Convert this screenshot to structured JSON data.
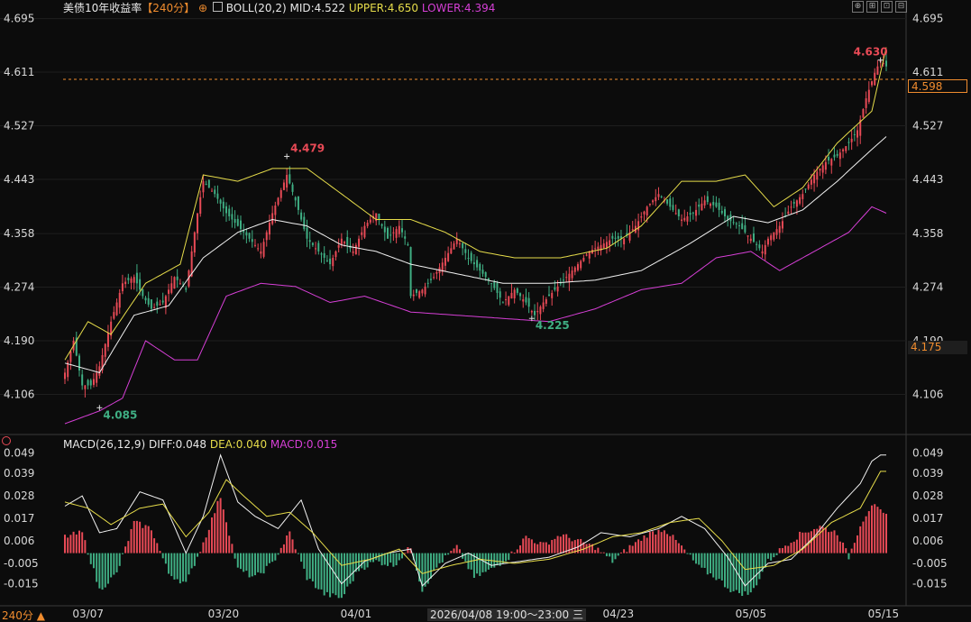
{
  "main_header": {
    "title": "美债10年收益率",
    "period_tag": "【240分】",
    "boll_label": "BOLL(20,2)",
    "mid": "MID:4.522",
    "upper": "UPPER:4.650",
    "lower": "LOWER:4.394"
  },
  "macd_header": {
    "label": "MACD(26,12,9)",
    "diff": "DIFF:0.048",
    "dea": "DEA:0.040",
    "macd": "MACD:0.015"
  },
  "toolbar": {
    "btn1": "⊕",
    "btn2": "⊞",
    "btn3": "⊡",
    "btn4": "⊟"
  },
  "price_marker": {
    "last": "4.598",
    "crosshair": "4.175"
  },
  "footer": {
    "period": "240分 ▲",
    "crosshair_time": "2026/04/08 19:00～23:00 三"
  },
  "colors": {
    "up": "#e84a56",
    "down": "#3fae83",
    "upper": "#e6dc4a",
    "mid": "#f0f0f0",
    "lower": "#d63fd6",
    "dea": "#e6dc4a",
    "diff": "#f0f0f0",
    "marker": "#f08c2e"
  },
  "chart_data": [
    {
      "type": "candlestick",
      "title": "美债10年收益率",
      "y_ticks": [
        "4.695",
        "4.611",
        "4.527",
        "4.443",
        "4.358",
        "4.274",
        "4.190",
        "4.106"
      ],
      "ylim": [
        4.06,
        4.71
      ],
      "x_ticks": [
        "03/07",
        "03/20",
        "04/01",
        "04/23",
        "05/05",
        "05/15"
      ],
      "annotations": [
        {
          "label": "4.479",
          "x": 77,
          "value": 4.479,
          "kind": "high"
        },
        {
          "label": "4.085",
          "x": 12,
          "value": 4.085,
          "kind": "low"
        },
        {
          "label": "4.225",
          "x": 162,
          "value": 4.225,
          "kind": "low"
        },
        {
          "label": "4.630",
          "x": 283,
          "value": 4.63,
          "kind": "high"
        }
      ],
      "anchors": [
        [
          0,
          4.14
        ],
        [
          3,
          4.19
        ],
        [
          6,
          4.12
        ],
        [
          9,
          4.12
        ],
        [
          12,
          4.15
        ],
        [
          16,
          4.22
        ],
        [
          20,
          4.28
        ],
        [
          24,
          4.29
        ],
        [
          27,
          4.26
        ],
        [
          30,
          4.24
        ],
        [
          34,
          4.25
        ],
        [
          38,
          4.29
        ],
        [
          42,
          4.27
        ],
        [
          46,
          4.39
        ],
        [
          48,
          4.44
        ],
        [
          52,
          4.42
        ],
        [
          56,
          4.39
        ],
        [
          60,
          4.37
        ],
        [
          64,
          4.35
        ],
        [
          68,
          4.33
        ],
        [
          72,
          4.39
        ],
        [
          77,
          4.45
        ],
        [
          80,
          4.41
        ],
        [
          84,
          4.35
        ],
        [
          88,
          4.33
        ],
        [
          92,
          4.31
        ],
        [
          96,
          4.35
        ],
        [
          100,
          4.33
        ],
        [
          104,
          4.37
        ],
        [
          108,
          4.39
        ],
        [
          112,
          4.35
        ],
        [
          116,
          4.37
        ],
        [
          119,
          4.34
        ],
        [
          120,
          4.26
        ],
        [
          124,
          4.27
        ],
        [
          128,
          4.29
        ],
        [
          132,
          4.32
        ],
        [
          136,
          4.35
        ],
        [
          140,
          4.32
        ],
        [
          144,
          4.3
        ],
        [
          148,
          4.28
        ],
        [
          152,
          4.25
        ],
        [
          156,
          4.27
        ],
        [
          160,
          4.25
        ],
        [
          163,
          4.23
        ],
        [
          166,
          4.25
        ],
        [
          170,
          4.27
        ],
        [
          174,
          4.29
        ],
        [
          178,
          4.31
        ],
        [
          182,
          4.33
        ],
        [
          186,
          4.34
        ],
        [
          190,
          4.35
        ],
        [
          194,
          4.35
        ],
        [
          198,
          4.37
        ],
        [
          202,
          4.4
        ],
        [
          206,
          4.42
        ],
        [
          210,
          4.4
        ],
        [
          214,
          4.38
        ],
        [
          218,
          4.39
        ],
        [
          222,
          4.41
        ],
        [
          226,
          4.4
        ],
        [
          230,
          4.38
        ],
        [
          234,
          4.37
        ],
        [
          238,
          4.35
        ],
        [
          242,
          4.33
        ],
        [
          244,
          4.35
        ],
        [
          248,
          4.37
        ],
        [
          252,
          4.4
        ],
        [
          256,
          4.42
        ],
        [
          260,
          4.45
        ],
        [
          264,
          4.47
        ],
        [
          268,
          4.48
        ],
        [
          272,
          4.5
        ],
        [
          275,
          4.52
        ],
        [
          278,
          4.57
        ],
        [
          281,
          4.61
        ],
        [
          283,
          4.63
        ],
        [
          285,
          4.62
        ]
      ],
      "series": [
        {
          "name": "MID",
          "anchors": [
            [
              0,
              4.155
            ],
            [
              12,
              4.14
            ],
            [
              24,
              4.23
            ],
            [
              36,
              4.245
            ],
            [
              48,
              4.32
            ],
            [
              60,
              4.36
            ],
            [
              72,
              4.38
            ],
            [
              84,
              4.37
            ],
            [
              96,
              4.34
            ],
            [
              108,
              4.33
            ],
            [
              120,
              4.31
            ],
            [
              136,
              4.295
            ],
            [
              152,
              4.28
            ],
            [
              168,
              4.28
            ],
            [
              184,
              4.285
            ],
            [
              200,
              4.3
            ],
            [
              216,
              4.34
            ],
            [
              232,
              4.385
            ],
            [
              244,
              4.375
            ],
            [
              256,
              4.395
            ],
            [
              268,
              4.44
            ],
            [
              280,
              4.49
            ],
            [
              285,
              4.51
            ]
          ]
        },
        {
          "name": "UPPER",
          "anchors": [
            [
              0,
              4.16
            ],
            [
              8,
              4.22
            ],
            [
              16,
              4.2
            ],
            [
              28,
              4.28
            ],
            [
              40,
              4.31
            ],
            [
              48,
              4.45
            ],
            [
              60,
              4.44
            ],
            [
              72,
              4.46
            ],
            [
              84,
              4.46
            ],
            [
              96,
              4.42
            ],
            [
              108,
              4.38
            ],
            [
              120,
              4.38
            ],
            [
              132,
              4.36
            ],
            [
              144,
              4.33
            ],
            [
              156,
              4.32
            ],
            [
              172,
              4.32
            ],
            [
              188,
              4.335
            ],
            [
              200,
              4.37
            ],
            [
              214,
              4.44
            ],
            [
              226,
              4.44
            ],
            [
              236,
              4.45
            ],
            [
              246,
              4.4
            ],
            [
              256,
              4.43
            ],
            [
              268,
              4.5
            ],
            [
              280,
              4.55
            ],
            [
              285,
              4.65
            ]
          ]
        },
        {
          "name": "LOWER",
          "anchors": [
            [
              0,
              4.06
            ],
            [
              12,
              4.08
            ],
            [
              20,
              4.1
            ],
            [
              28,
              4.19
            ],
            [
              38,
              4.16
            ],
            [
              46,
              4.16
            ],
            [
              56,
              4.26
            ],
            [
              68,
              4.28
            ],
            [
              80,
              4.275
            ],
            [
              92,
              4.25
            ],
            [
              104,
              4.26
            ],
            [
              120,
              4.235
            ],
            [
              136,
              4.23
            ],
            [
              152,
              4.225
            ],
            [
              168,
              4.22
            ],
            [
              184,
              4.24
            ],
            [
              200,
              4.27
            ],
            [
              214,
              4.28
            ],
            [
              226,
              4.32
            ],
            [
              238,
              4.33
            ],
            [
              248,
              4.3
            ],
            [
              260,
              4.33
            ],
            [
              272,
              4.36
            ],
            [
              280,
              4.4
            ],
            [
              285,
              4.39
            ]
          ]
        }
      ]
    },
    {
      "type": "bar",
      "title": "MACD(26,12,9)",
      "y_ticks": [
        "0.049",
        "0.039",
        "0.028",
        "0.017",
        "0.006",
        "-0.005",
        "-0.015"
      ],
      "ylim": [
        -0.024,
        0.051
      ],
      "series": [
        {
          "name": "DIFF",
          "anchors": [
            [
              0,
              0.023
            ],
            [
              6,
              0.028
            ],
            [
              12,
              0.01
            ],
            [
              18,
              0.012
            ],
            [
              26,
              0.03
            ],
            [
              34,
              0.026
            ],
            [
              42,
              0.0
            ],
            [
              48,
              0.018
            ],
            [
              54,
              0.048
            ],
            [
              60,
              0.025
            ],
            [
              66,
              0.018
            ],
            [
              74,
              0.012
            ],
            [
              82,
              0.026
            ],
            [
              88,
              0.002
            ],
            [
              96,
              -0.015
            ],
            [
              104,
              -0.004
            ],
            [
              112,
              0.0
            ],
            [
              120,
              0.002
            ],
            [
              124,
              -0.016
            ],
            [
              132,
              -0.005
            ],
            [
              140,
              0.0
            ],
            [
              148,
              -0.006
            ],
            [
              158,
              -0.004
            ],
            [
              168,
              -0.002
            ],
            [
              178,
              0.003
            ],
            [
              186,
              0.01
            ],
            [
              196,
              0.008
            ],
            [
              206,
              0.012
            ],
            [
              214,
              0.018
            ],
            [
              222,
              0.012
            ],
            [
              230,
              -0.002
            ],
            [
              236,
              -0.016
            ],
            [
              244,
              -0.005
            ],
            [
              252,
              -0.003
            ],
            [
              260,
              0.008
            ],
            [
              268,
              0.022
            ],
            [
              276,
              0.034
            ],
            [
              280,
              0.045
            ],
            [
              283,
              0.048
            ]
          ]
        },
        {
          "name": "DEA",
          "anchors": [
            [
              0,
              0.025
            ],
            [
              8,
              0.022
            ],
            [
              16,
              0.014
            ],
            [
              26,
              0.022
            ],
            [
              34,
              0.024
            ],
            [
              42,
              0.008
            ],
            [
              50,
              0.02
            ],
            [
              56,
              0.036
            ],
            [
              62,
              0.028
            ],
            [
              70,
              0.018
            ],
            [
              78,
              0.02
            ],
            [
              86,
              0.01
            ],
            [
              96,
              -0.006
            ],
            [
              106,
              -0.003
            ],
            [
              116,
              0.002
            ],
            [
              124,
              -0.01
            ],
            [
              134,
              -0.006
            ],
            [
              144,
              -0.003
            ],
            [
              156,
              -0.005
            ],
            [
              168,
              -0.003
            ],
            [
              180,
              0.002
            ],
            [
              190,
              0.008
            ],
            [
              200,
              0.01
            ],
            [
              210,
              0.015
            ],
            [
              220,
              0.017
            ],
            [
              228,
              0.006
            ],
            [
              236,
              -0.008
            ],
            [
              246,
              -0.006
            ],
            [
              256,
              0.002
            ],
            [
              266,
              0.015
            ],
            [
              276,
              0.022
            ],
            [
              283,
              0.04
            ]
          ]
        },
        {
          "name": "MACD",
          "anchors": [
            [
              0,
              0.008
            ],
            [
              6,
              0.01
            ],
            [
              12,
              -0.018
            ],
            [
              18,
              -0.01
            ],
            [
              24,
              0.015
            ],
            [
              30,
              0.012
            ],
            [
              36,
              -0.01
            ],
            [
              42,
              -0.015
            ],
            [
              48,
              0.005
            ],
            [
              54,
              0.028
            ],
            [
              60,
              -0.008
            ],
            [
              66,
              -0.012
            ],
            [
              72,
              -0.005
            ],
            [
              78,
              0.01
            ],
            [
              84,
              -0.012
            ],
            [
              90,
              -0.02
            ],
            [
              96,
              -0.022
            ],
            [
              102,
              -0.008
            ],
            [
              108,
              -0.004
            ],
            [
              114,
              -0.006
            ],
            [
              120,
              0.003
            ],
            [
              124,
              -0.018
            ],
            [
              130,
              -0.005
            ],
            [
              136,
              0.003
            ],
            [
              142,
              -0.012
            ],
            [
              148,
              -0.008
            ],
            [
              154,
              -0.002
            ],
            [
              160,
              0.008
            ],
            [
              166,
              0.004
            ],
            [
              172,
              0.009
            ],
            [
              178,
              0.006
            ],
            [
              184,
              0.003
            ],
            [
              190,
              -0.004
            ],
            [
              196,
              0.003
            ],
            [
              202,
              0.009
            ],
            [
              208,
              0.012
            ],
            [
              214,
              0.003
            ],
            [
              220,
              -0.007
            ],
            [
              226,
              -0.012
            ],
            [
              232,
              -0.019
            ],
            [
              238,
              -0.02
            ],
            [
              244,
              -0.004
            ],
            [
              250,
              0.004
            ],
            [
              256,
              0.01
            ],
            [
              262,
              0.013
            ],
            [
              268,
              0.01
            ],
            [
              272,
              -0.002
            ],
            [
              276,
              0.014
            ],
            [
              280,
              0.024
            ],
            [
              283,
              0.02
            ],
            [
              285,
              0.018
            ]
          ]
        }
      ]
    }
  ]
}
